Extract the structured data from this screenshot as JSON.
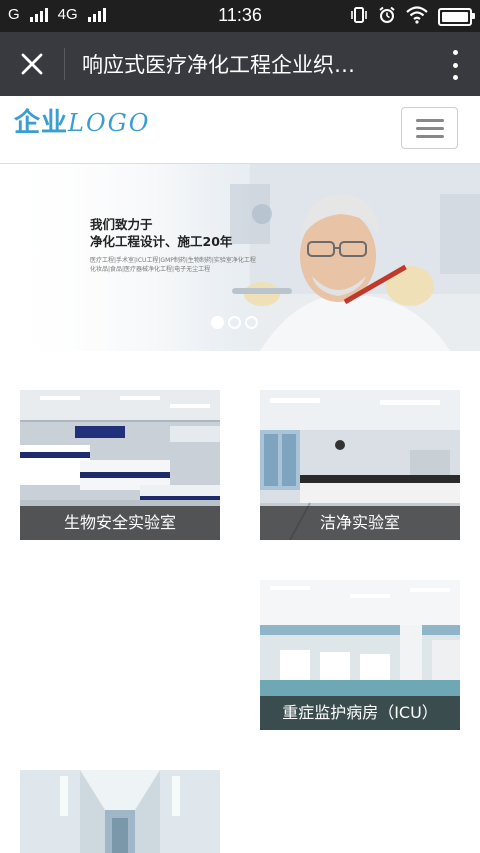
{
  "status_bar": {
    "carrier_1": "G",
    "carrier_2": "4G",
    "time": "11:36"
  },
  "webview": {
    "title": "响应式医疗净化工程企业织…"
  },
  "site": {
    "logo_cjk": "企业",
    "logo_latin": "LOGO",
    "brand_color": "#3a9ed0"
  },
  "banner": {
    "headline_1": "我们致力于",
    "headline_2": "净化工程设计、施工20年",
    "subline_1": "医疗工程|手术室|ICU工程|GMP制药|生物制药|实验室净化工程",
    "subline_2": "化妆品|食品|医疗器械净化工程|电子无尘工程",
    "slides": 3,
    "active_slide": 1
  },
  "products": [
    {
      "label": "生物安全实验室"
    },
    {
      "label": "洁净实验室"
    },
    {
      "label": "重症监护病房（ICU）"
    },
    {
      "label": ""
    }
  ]
}
